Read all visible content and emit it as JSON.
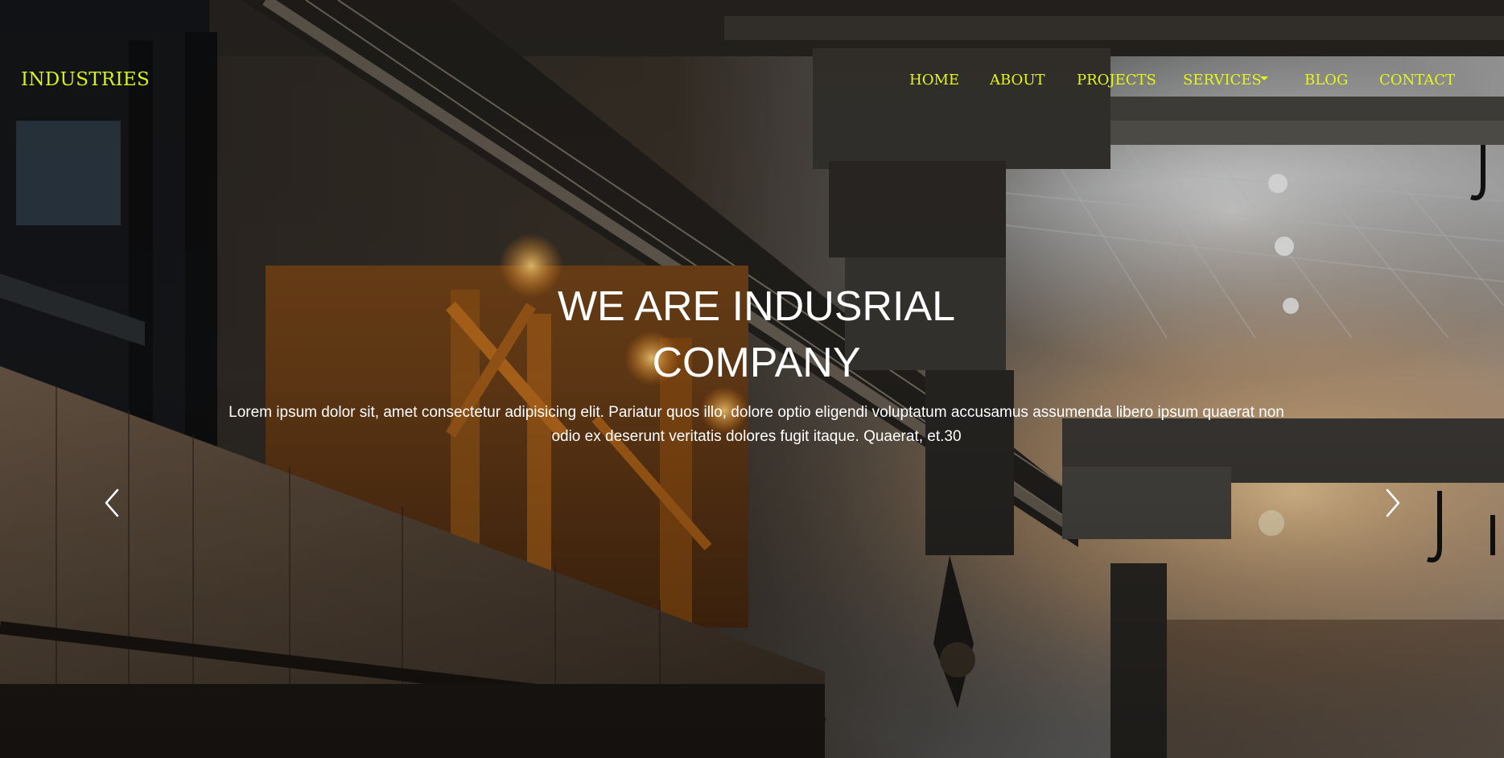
{
  "brand": {
    "name": "INDUSTRIES",
    "color": "#d9f21a"
  },
  "nav": {
    "items": [
      {
        "label": "HOME"
      },
      {
        "label": "ABOUT"
      },
      {
        "label": "PROJECTS"
      },
      {
        "label": "SERVICES",
        "has_dropdown": true
      },
      {
        "label": "BLOG"
      },
      {
        "label": "CONTACT"
      }
    ],
    "color": "#e4f51c"
  },
  "hero": {
    "title": "WE ARE INDUSRIAL COMPANY",
    "text": "Lorem ipsum dolor sit, amet consectetur adipisicing elit. Pariatur quos illo, dolore optio eligendi voluptatum accusamus assumenda libero ipsum quaerat non odio ex deserunt veritatis dolores fugit itaque. Quaerat, et.30",
    "background": "industrial-interior-scene"
  },
  "carousel": {
    "prev_icon": "chevron-left-icon",
    "next_icon": "chevron-right-icon"
  }
}
